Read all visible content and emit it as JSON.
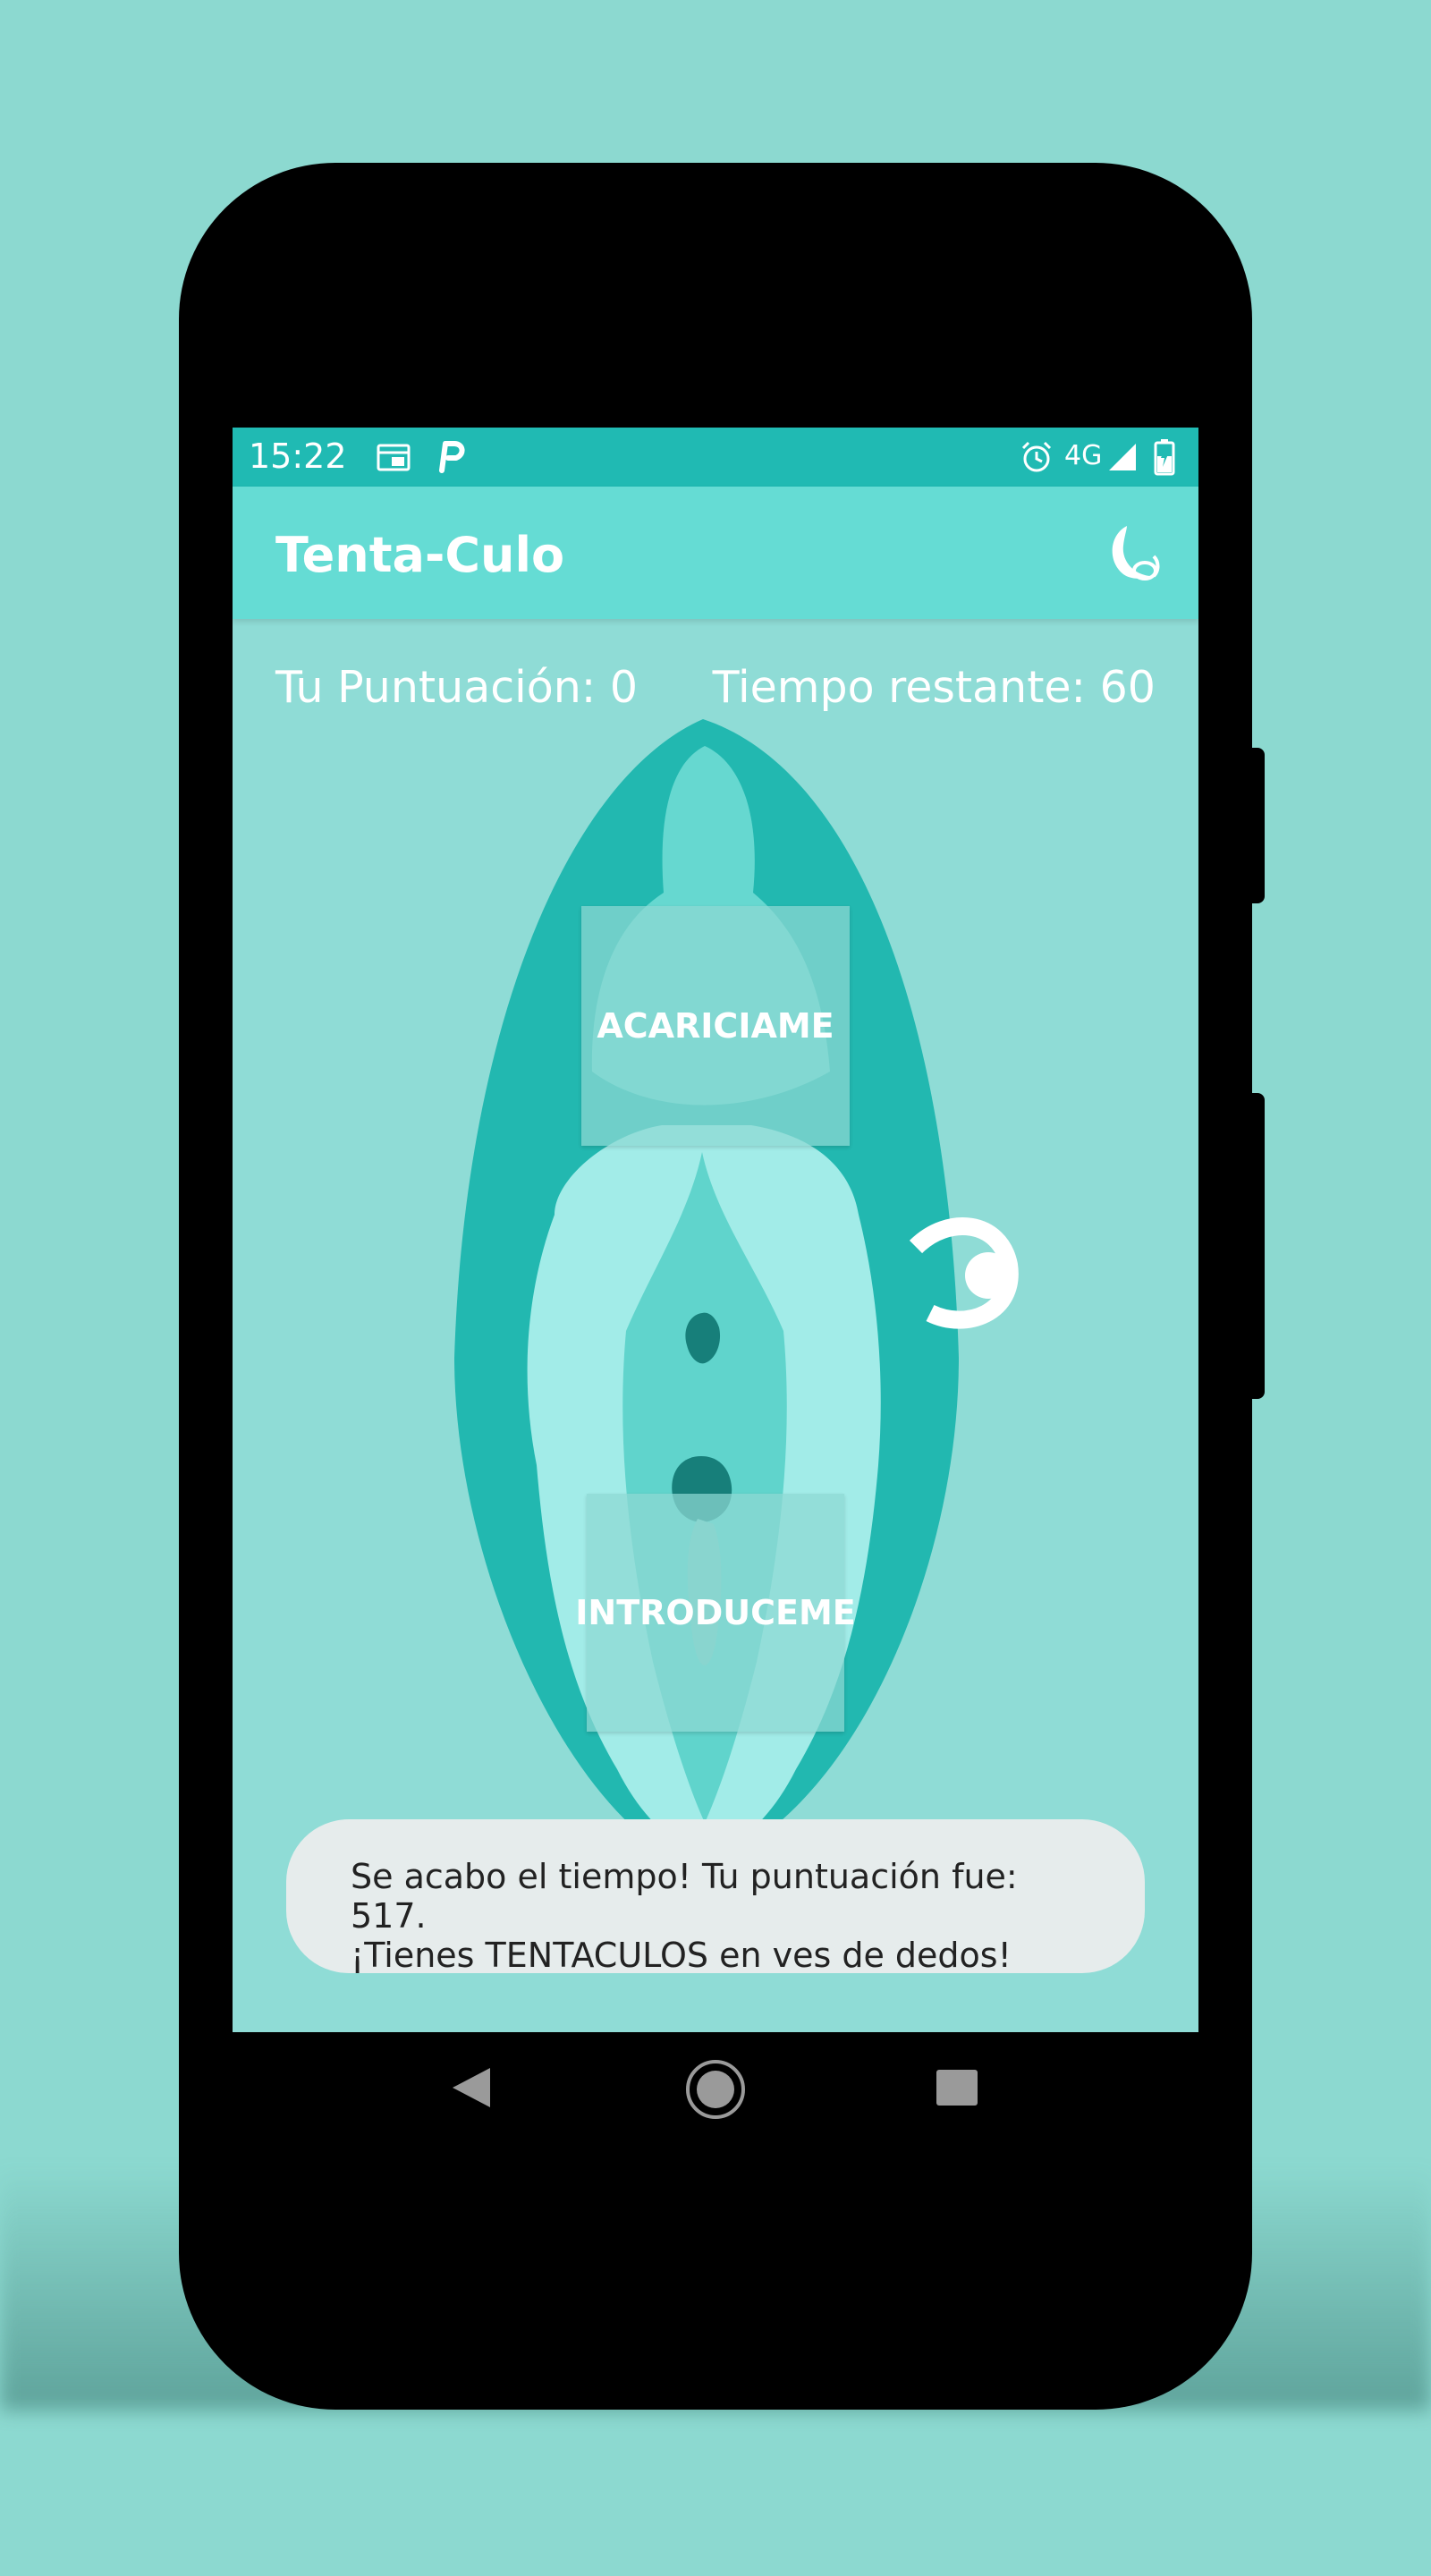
{
  "status_bar": {
    "time": "15:22",
    "network": "4G",
    "icons": [
      "calendar-icon",
      "parking-p-icon",
      "alarm-clock-icon",
      "signal-icon",
      "battery-charging-icon"
    ]
  },
  "app_bar": {
    "title": "Tenta-Culo",
    "action_icon": "moon-menu-icon"
  },
  "game": {
    "score_text": "Tu Puntuación: 0",
    "timer_text": "Tiempo restante: 60",
    "stroke_button": "ACARICIAME",
    "insert_button": "INTRODUCEME"
  },
  "toast": {
    "line1": "Se acabo el tiempo! Tu puntuación fue: 517.",
    "line2": "¡Tienes TENTACULOS en ves de dedos!"
  },
  "nav_bar": {
    "icons": [
      "back-icon",
      "home-icon",
      "recents-icon"
    ]
  },
  "colors": {
    "background": "#8cd9d0",
    "status_bar": "#20bab3",
    "app_bar": "#65dcd4",
    "screen": "#8fdcd6",
    "outer_shape": "#22b8b0",
    "inner_light": "#a2ece8"
  }
}
